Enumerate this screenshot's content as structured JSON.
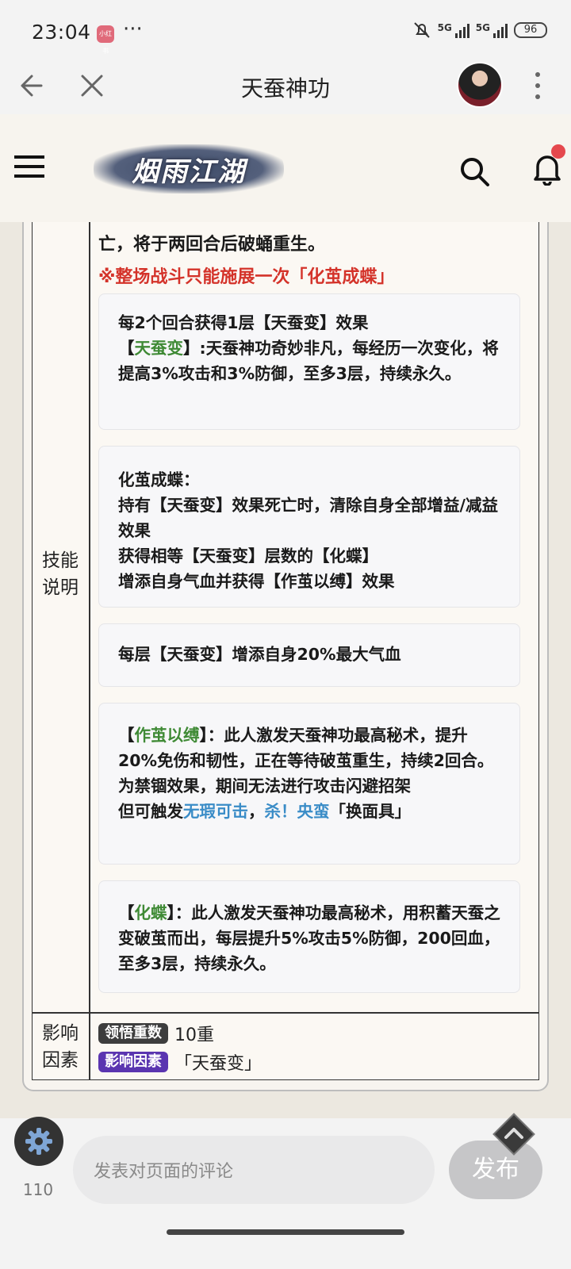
{
  "status_bar": {
    "time": "23:04",
    "app_badge": "小红书",
    "dots": "···",
    "signal1": "5G",
    "signal2": "5G",
    "battery": "96"
  },
  "nav": {
    "title": "天蚕神功"
  },
  "site": {
    "logo_text": "烟雨江湖"
  },
  "skill": {
    "top_line": "亡，将于两回合后破蛹重生。",
    "warning": "※整场战斗只能施展一次「化茧成蝶」",
    "label_skill": [
      "技能",
      "说明"
    ],
    "box1": {
      "line1": "每2个回合获得1层【天蚕变】效果",
      "bracket_open": "【",
      "term": "天蚕变",
      "rest": "】:天蚕神功奇妙非凡，每经历一次变化，将提高3%攻击和3%防御，至多3层，持续永久。"
    },
    "box2": {
      "line1": "化茧成蝶：",
      "line2": "持有【天蚕变】效果死亡时，清除自身全部增益/减益效果",
      "line3": "获得相等【天蚕变】层数的【化蝶】",
      "line4": "增添自身气血并获得【作茧以缚】效果"
    },
    "box3": {
      "line1": "每层【天蚕变】增添自身20%最大气血"
    },
    "box4": {
      "bracket_open": "【",
      "term": "作茧以缚",
      "rest": "】：此人激发天蚕神功最高秘术，提升20%免伤和韧性，正在等待破茧重生，持续2回合。",
      "line2": "为禁锢效果，期间无法进行攻击闪避招架",
      "line3_pre": "但可触发",
      "link1": "无瑕可击",
      "sep": "，",
      "link2": "杀！央蛮",
      "line3_post": "「换面具」"
    },
    "box5": {
      "bracket_open": "【",
      "term": "化蝶",
      "rest": "】：此人激发天蚕神功最高秘术，用积蓄天蚕之变破茧而出，每层提升5%攻击5%防御，200回血，至多3层，持续永久。"
    }
  },
  "factors": {
    "label": [
      "影响",
      "因素"
    ],
    "tag1": "领悟重数",
    "value1": "10重",
    "tag2": "影响因素",
    "value2": "「天蚕变」"
  },
  "bottom": {
    "count": "110",
    "comment_placeholder": "发表对页面的评论",
    "publish": "发布"
  },
  "colors": {
    "warning_red": "#d4332a",
    "term_green": "#3f8a35",
    "link_blue": "#3a8cc7",
    "tag_dark": "#3d3d3d",
    "tag_purple": "#5a35b0"
  }
}
